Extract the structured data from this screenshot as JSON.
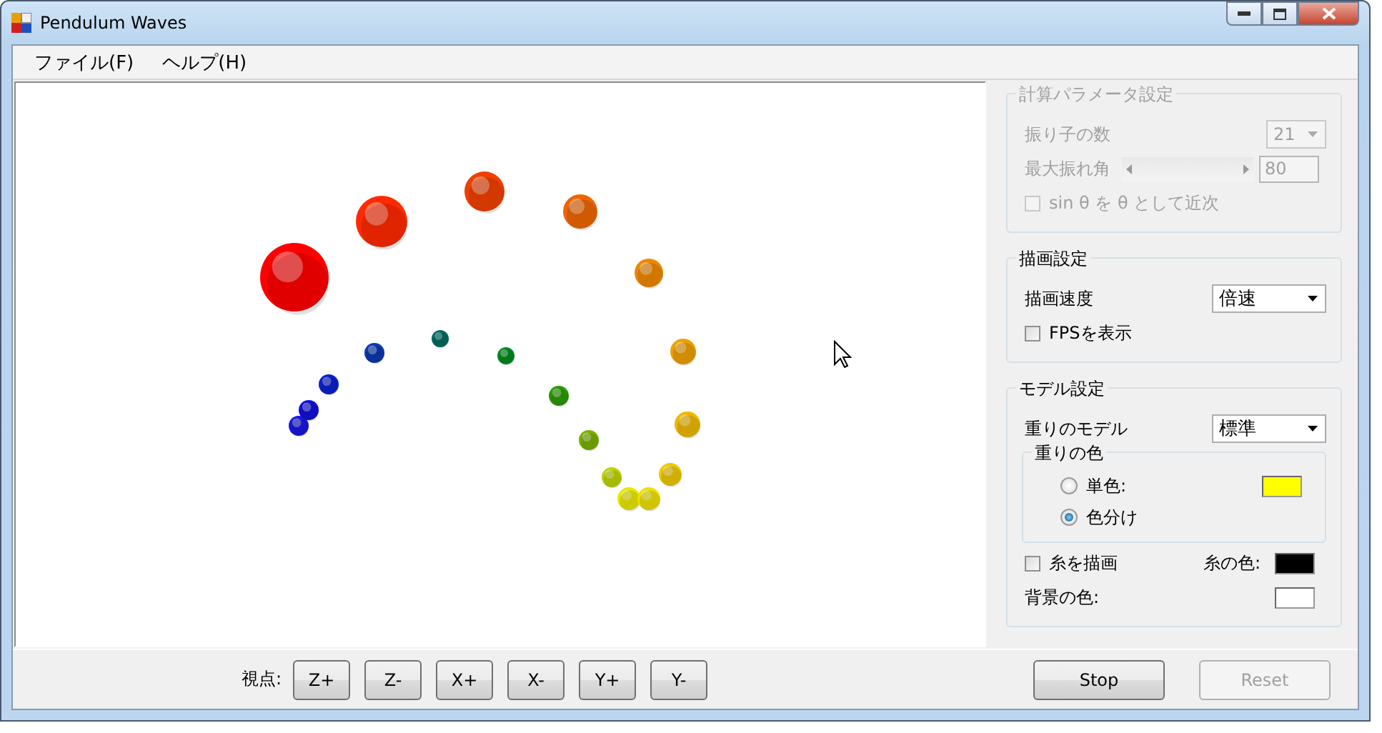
{
  "window": {
    "title": "Pendulum Waves"
  },
  "menu": [
    {
      "label": "ファイル(F)"
    },
    {
      "label": "ヘルプ(H)"
    }
  ],
  "params": {
    "title": "計算パラメータ設定",
    "disabled": true,
    "count": {
      "label": "振り子の数",
      "value": "21"
    },
    "angle": {
      "label": "最大振れ角",
      "value": "80"
    },
    "approx": {
      "label": "sin θ を θ として近次",
      "checked": false
    }
  },
  "display": {
    "title": "描画設定",
    "speed": {
      "label": "描画速度",
      "value": "倍速"
    },
    "fps": {
      "label": "FPSを表示",
      "checked": false
    }
  },
  "model": {
    "title": "モデル設定",
    "weight": {
      "label": "重りのモデル",
      "value": "標準"
    },
    "color_group": {
      "title": "重りの色",
      "options": [
        {
          "label": "単色:",
          "selected": false,
          "color": "#ffff00"
        },
        {
          "label": "色分け",
          "selected": true
        }
      ]
    },
    "draw_string": {
      "label": "糸を描画",
      "checked": false
    },
    "string_color": {
      "label": "糸の色:",
      "color": "#000000"
    },
    "background_color": {
      "label": "背景の色:",
      "color": "#ffffff"
    }
  },
  "view": {
    "label": "視点:",
    "buttons": [
      "Z+",
      "Z-",
      "X+",
      "X-",
      "Y+",
      "Y-"
    ]
  },
  "actions": [
    {
      "label": "Stop",
      "disabled": false
    },
    {
      "label": "Reset",
      "disabled": true
    }
  ]
}
